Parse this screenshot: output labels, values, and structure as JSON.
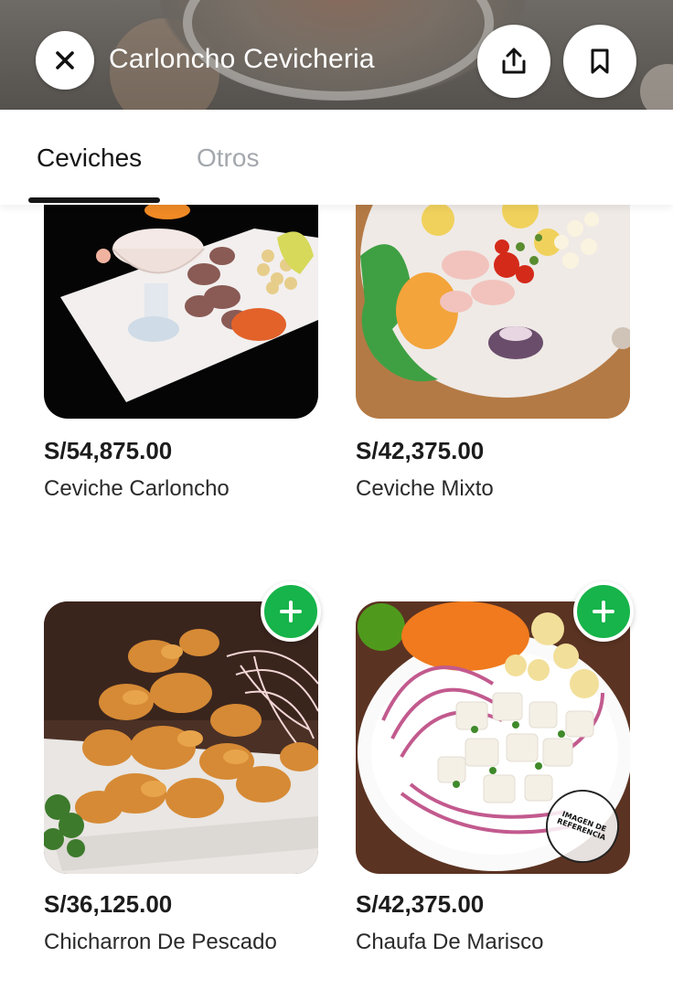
{
  "header": {
    "store_name": "Carloncho Cevicheria",
    "close_icon": "close-icon",
    "share_icon": "share-icon",
    "bookmark_icon": "bookmark-icon"
  },
  "tabs": [
    {
      "label": "Ceviches",
      "active": true
    },
    {
      "label": "Otros",
      "active": false
    }
  ],
  "products": [
    {
      "price": "S/54,875.00",
      "name": "Ceviche Carloncho",
      "has_add_button": false
    },
    {
      "price": "S/42,375.00",
      "name": "Ceviche Mixto",
      "has_add_button": false
    },
    {
      "price": "S/36,125.00",
      "name": "Chicharron De Pescado",
      "has_add_button": true
    },
    {
      "price": "S/42,375.00",
      "name": "Chaufa De Marisco",
      "has_add_button": true,
      "watermark": "IMAGEN DE REFERENCIA"
    }
  ],
  "colors": {
    "accent_green": "#16b44a",
    "tab_active": "#151515",
    "tab_inactive": "#a3a8ad"
  }
}
